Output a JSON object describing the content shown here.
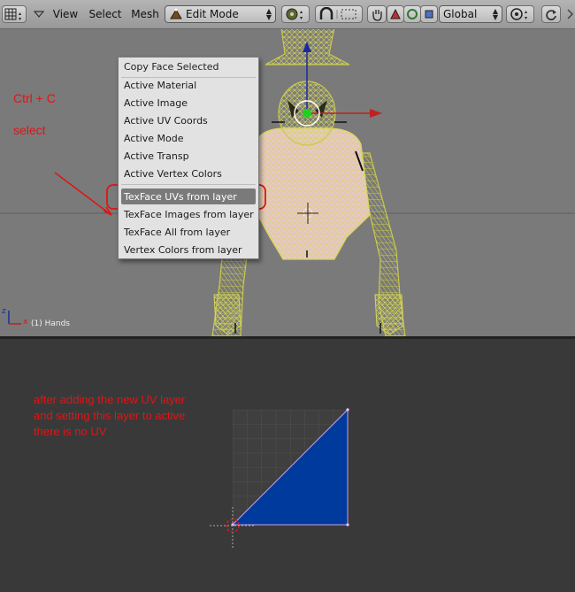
{
  "toolbar": {
    "menus": [
      "View",
      "Select",
      "Mesh"
    ],
    "mode": "Edit Mode",
    "orientation": "Global"
  },
  "context_menu": {
    "items": [
      "Copy Face Selected",
      "Active Material",
      "Active Image",
      "Active UV Coords",
      "Active Mode",
      "Active Transp",
      "Active Vertex Colors",
      "TexFace UVs from layer",
      "TexFace Images from layer",
      "TexFace All from layer",
      "Vertex Colors from layer"
    ],
    "highlighted_index": 7
  },
  "annotations": {
    "shortcut": "Ctrl + C",
    "select": "select",
    "uv_note": [
      "after adding the new UV layer",
      "and setting this layer to active",
      "there is no UV"
    ]
  },
  "viewport": {
    "object_label": "(1) Hands",
    "axis_x": "x",
    "axis_z": "z"
  },
  "colors": {
    "wire": "#d6d65a",
    "skin": "#e8c6cf",
    "annotation": "#e01515",
    "uv_face": "#003a9c",
    "menu_highlight": "#7a7a7a"
  }
}
